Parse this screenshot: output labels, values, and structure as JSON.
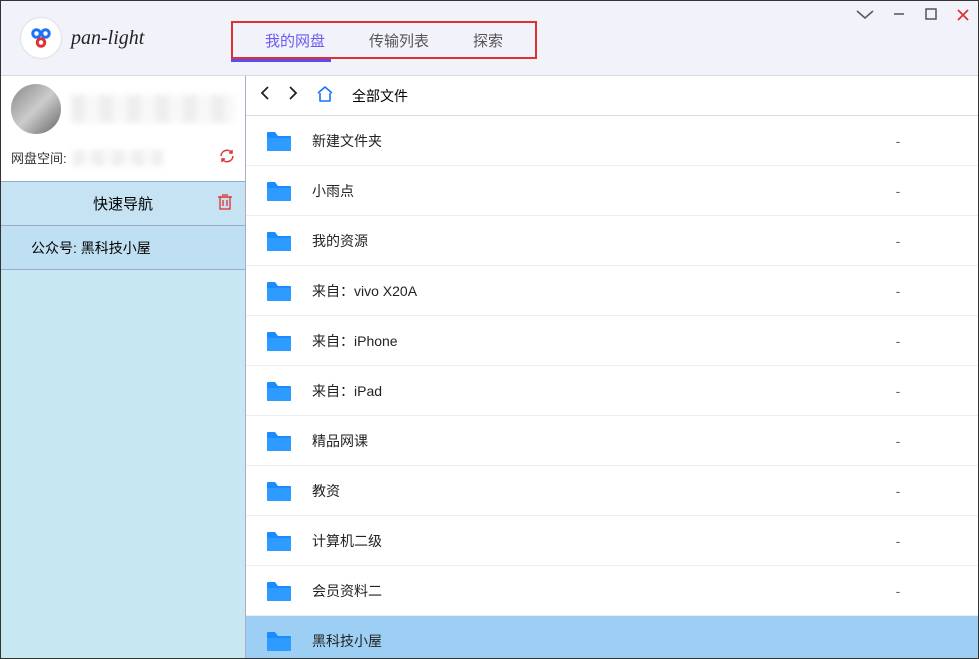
{
  "app": {
    "title": "pan-light"
  },
  "tabs": [
    {
      "label": "我的网盘",
      "active": true
    },
    {
      "label": "传输列表",
      "active": false
    },
    {
      "label": "探索",
      "active": false
    }
  ],
  "sidebar": {
    "space_label": "网盘空间:",
    "quick_nav": "快速导航",
    "subscribe_label": "公众号: 黑科技小屋"
  },
  "breadcrumb": {
    "current": "全部文件"
  },
  "files": [
    {
      "name": "新建文件夹",
      "meta": "-",
      "selected": false
    },
    {
      "name": "小雨点",
      "meta": "-",
      "selected": false
    },
    {
      "name": "我的资源",
      "meta": "-",
      "selected": false
    },
    {
      "name": "来自：vivo X20A",
      "meta": "-",
      "selected": false
    },
    {
      "name": "来自：iPhone",
      "meta": "-",
      "selected": false
    },
    {
      "name": "来自：iPad",
      "meta": "-",
      "selected": false
    },
    {
      "name": "精品网课",
      "meta": "-",
      "selected": false
    },
    {
      "name": "教资",
      "meta": "-",
      "selected": false
    },
    {
      "name": "计算机二级",
      "meta": "-",
      "selected": false
    },
    {
      "name": "会员资料二",
      "meta": "-",
      "selected": false
    },
    {
      "name": "黑科技小屋",
      "meta": "",
      "selected": true
    }
  ]
}
